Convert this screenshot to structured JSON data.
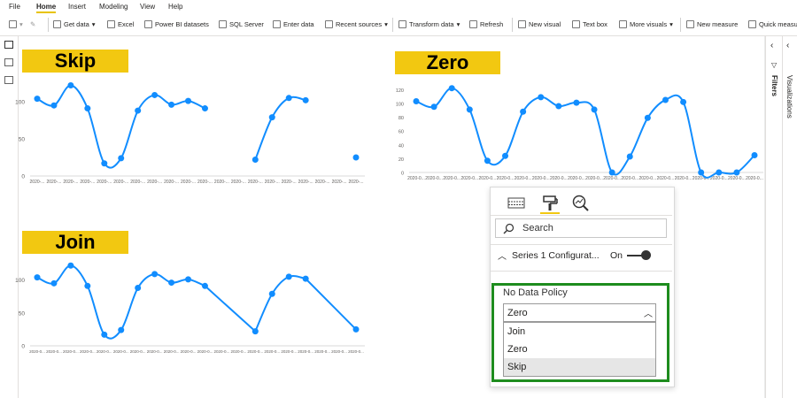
{
  "menu": {
    "items": [
      "File",
      "Home",
      "Insert",
      "Modeling",
      "View",
      "Help"
    ],
    "active_index": 1
  },
  "ribbon": {
    "buttons": [
      {
        "label": "Get data",
        "dropdown": true
      },
      {
        "label": "Excel"
      },
      {
        "label": "Power BI datasets"
      },
      {
        "label": "SQL Server"
      },
      {
        "label": "Enter data"
      },
      {
        "label": "Recent sources",
        "dropdown": true
      },
      {
        "label": "Transform data",
        "dropdown": true
      },
      {
        "label": "Refresh"
      },
      {
        "label": "New visual"
      },
      {
        "label": "Text box"
      },
      {
        "label": "More visuals",
        "dropdown": true
      },
      {
        "label": "New measure"
      },
      {
        "label": "Quick measure"
      }
    ]
  },
  "right_panel": {
    "filters_label": "Filters",
    "visualizations_label": "Visualizations"
  },
  "charts": [
    {
      "title": "Skip",
      "policy": "skip"
    },
    {
      "title": "Zero",
      "policy": "zero"
    },
    {
      "title": "Join",
      "policy": "join"
    }
  ],
  "chart_data": [
    {
      "type": "line",
      "title": "Skip",
      "x_tick_label": "2020-...",
      "y_ticks": [
        0,
        50,
        100
      ],
      "ylim": [
        0,
        125
      ],
      "values": [
        104,
        95,
        122,
        91,
        17,
        24,
        88,
        109,
        96,
        101,
        91,
        null,
        null,
        22,
        79,
        105,
        102,
        null,
        null,
        25
      ],
      "color": "#118dff"
    },
    {
      "type": "line",
      "title": "Zero",
      "x_tick_label": "2020-0...",
      "y_ticks": [
        0,
        20,
        40,
        60,
        80,
        100,
        120
      ],
      "ylim": [
        0,
        128
      ],
      "values": [
        103,
        95,
        122,
        91,
        17,
        24,
        88,
        109,
        96,
        101,
        91,
        0,
        23,
        79,
        105,
        102,
        0,
        0,
        0,
        25
      ],
      "color": "#118dff"
    },
    {
      "type": "line",
      "title": "Join",
      "x_tick_label": "2020-0...",
      "y_ticks": [
        0,
        50,
        100
      ],
      "ylim": [
        0,
        125
      ],
      "values": [
        104,
        95,
        122,
        91,
        17,
        24,
        88,
        109,
        96,
        101,
        91,
        null,
        null,
        22,
        79,
        105,
        102,
        null,
        null,
        25
      ],
      "color": "#118dff"
    }
  ],
  "format_pane": {
    "search_placeholder": "Search",
    "section_label": "Series 1 Configurat...",
    "toggle_label": "On",
    "field_label": "No Data Policy",
    "selected_value": "Zero",
    "options": [
      "Join",
      "Zero",
      "Skip"
    ],
    "hovered_option": "Skip"
  }
}
